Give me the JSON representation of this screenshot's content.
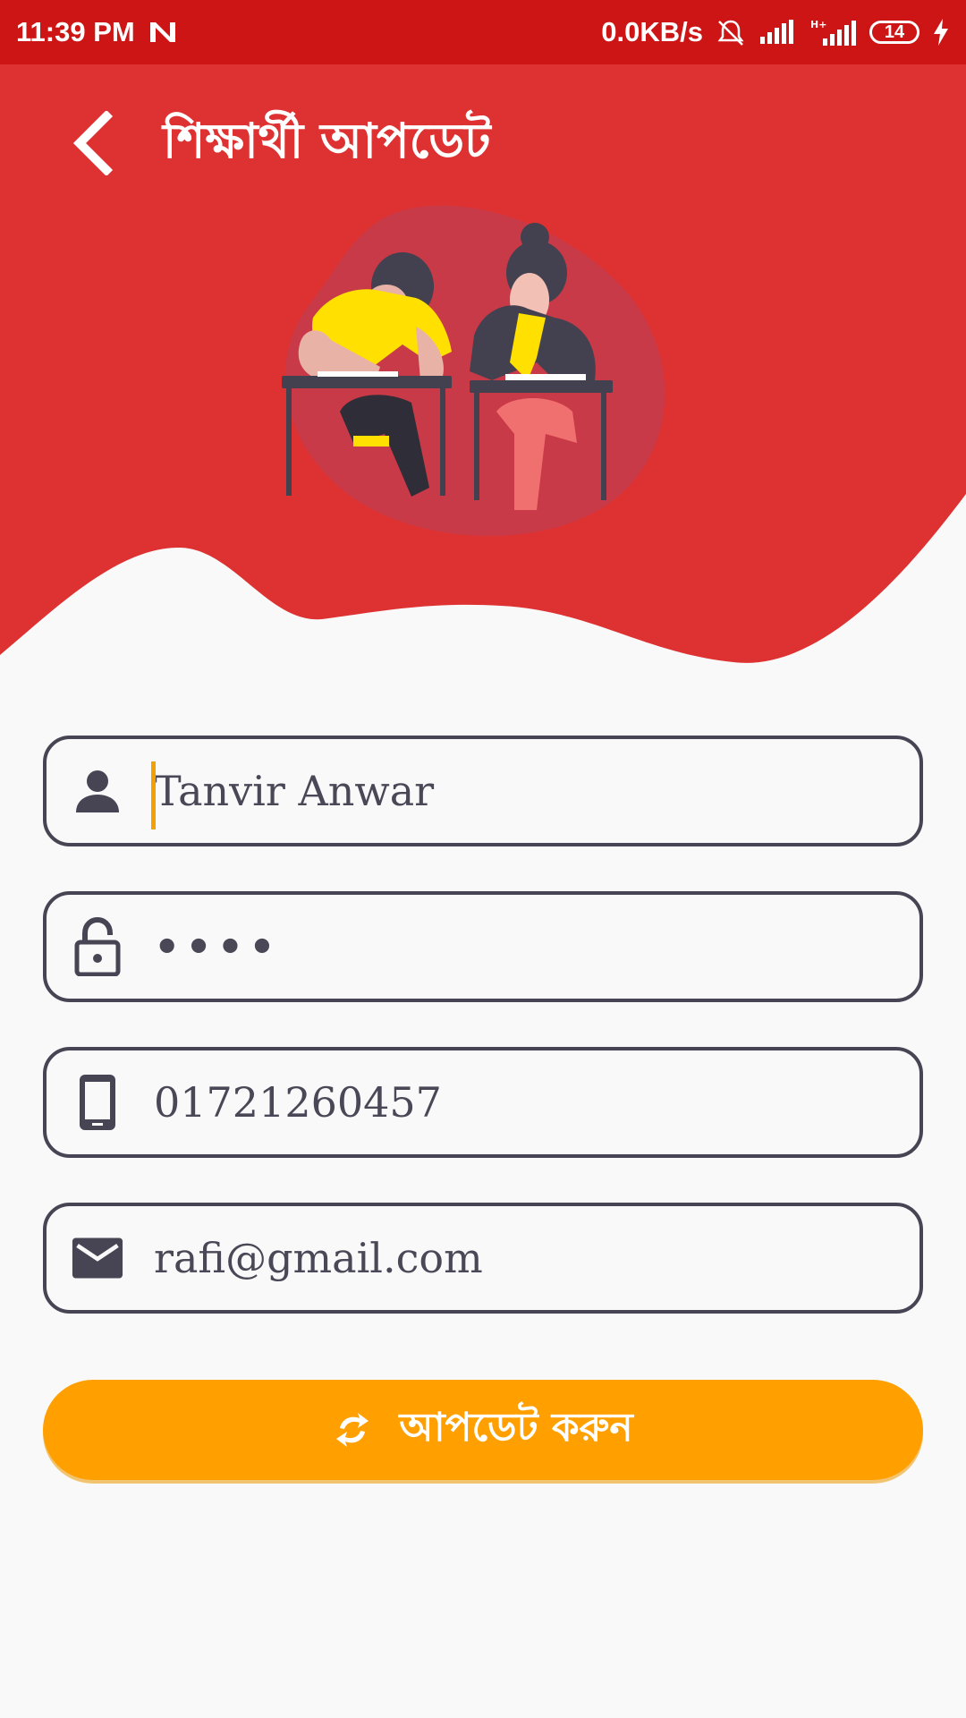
{
  "status_bar": {
    "time": "11:39 PM",
    "network_speed": "0.0KB/s",
    "battery_level": "14",
    "icons": [
      "notification-n-icon",
      "mute-bell-icon",
      "signal-icon",
      "hplus-signal-icon",
      "battery-icon",
      "charging-bolt-icon"
    ]
  },
  "header": {
    "title": "শিক্ষার্থী আপডেট",
    "back_icon": "chevron-left-icon",
    "background_color": "#de3232"
  },
  "form": {
    "name": {
      "value": "Tanvir Anwar",
      "icon": "person-icon"
    },
    "password": {
      "value": "••••",
      "icon": "unlock-icon"
    },
    "phone": {
      "value": "01721260457",
      "icon": "phone-icon"
    },
    "email": {
      "value": "rafi@gmail.com",
      "icon": "mail-icon"
    }
  },
  "update_button": {
    "label": "আপডেট করুন",
    "icon": "refresh-icon",
    "color": "#ff9f00"
  },
  "colors": {
    "status_bar": "#cd1515",
    "accent": "#ff9f00",
    "field_border": "#474554"
  }
}
